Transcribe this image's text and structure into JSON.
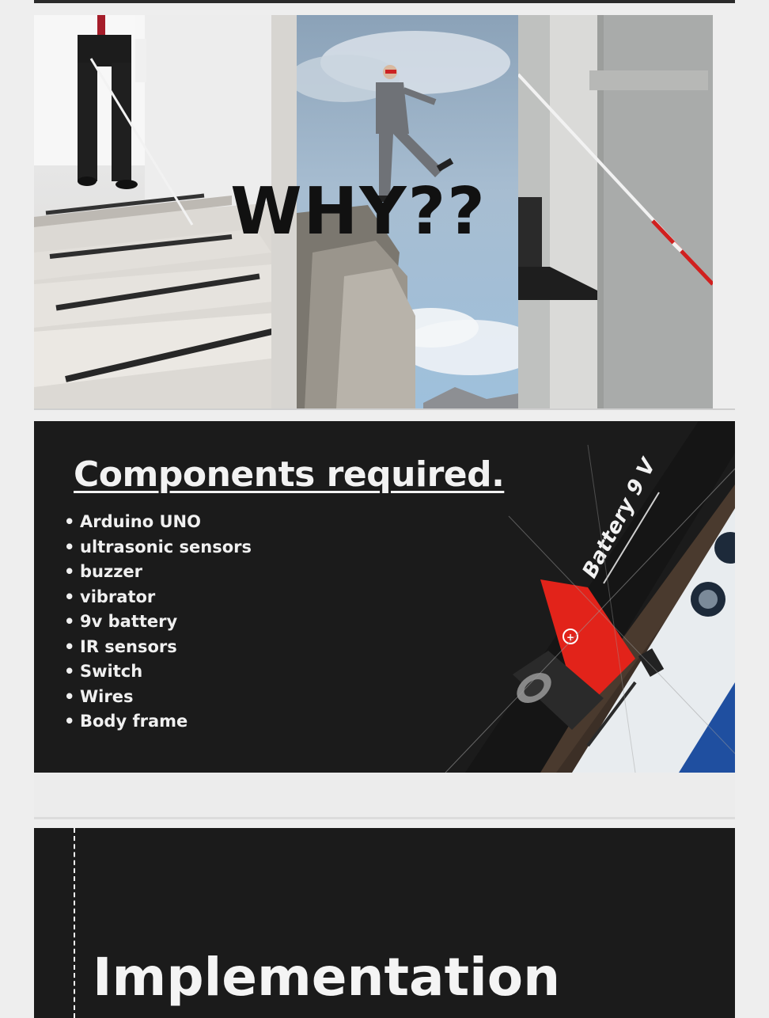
{
  "slides": [
    {
      "id": "why-slide",
      "heading": "WHY??",
      "images": [
        "stairs-cane-photo",
        "cliff-walker-photo",
        "street-cane-photo"
      ]
    },
    {
      "id": "components-slide",
      "title": "Components required.",
      "items": [
        "Arduino UNO",
        "ultrasonic sensors",
        "buzzer",
        "vibrator",
        "9v battery",
        "IR sensors",
        "Switch",
        "Wires",
        "Body frame"
      ],
      "battery_label": "Battery 9 V",
      "plus_symbol": "+"
    },
    {
      "id": "implementation-slide",
      "title": "Implementation"
    }
  ],
  "colors": {
    "page_bg": "#eeeeee",
    "dark_slide_bg": "#1b1b1b",
    "battery_red": "#e2231a",
    "cane_red": "#d0201f"
  }
}
